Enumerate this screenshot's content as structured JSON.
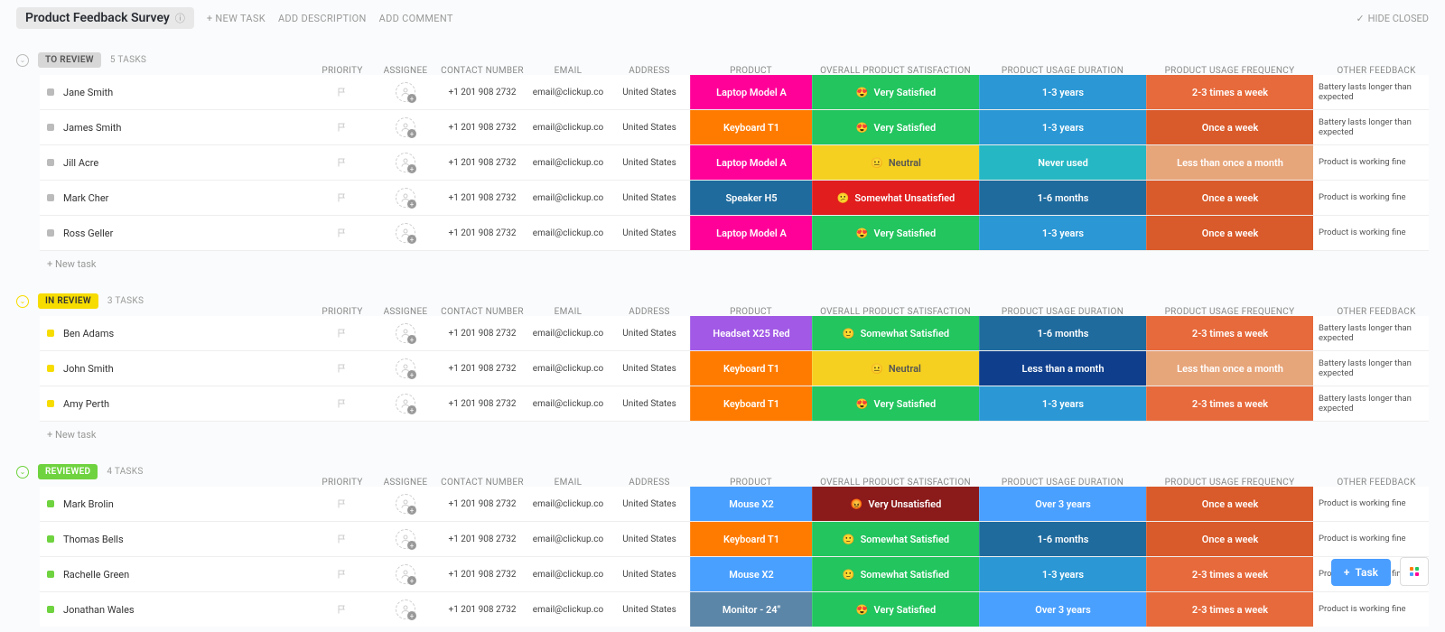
{
  "header": {
    "title": "Product Feedback Survey",
    "new_task": "+ NEW TASK",
    "add_description": "ADD DESCRIPTION",
    "add_comment": "ADD COMMENT",
    "hide_closed": "HIDE CLOSED"
  },
  "columns": {
    "priority": "PRIORITY",
    "assignee": "ASSIGNEE",
    "contact": "CONTACT NUMBER",
    "email": "EMAIL",
    "address": "ADDRESS",
    "product": "PRODUCT",
    "satisfaction": "OVERALL PRODUCT SATISFACTION",
    "duration": "PRODUCT USAGE DURATION",
    "frequency": "PRODUCT USAGE FREQUENCY",
    "feedback": "OTHER FEEDBACK"
  },
  "new_task_label": "+ New task",
  "fab_label": "Task",
  "colors": {
    "product": {
      "Laptop Model A": "#ff0099",
      "Keyboard T1": "#ff7b00",
      "Speaker H5": "#1f6b9e",
      "Headset X25 Red": "#a259e6",
      "Mouse X2": "#4aa0ff",
      "Monitor - 24\"": "#5b86a8"
    },
    "satisfaction": {
      "Very Satisfied": "#22c55e",
      "Neutral": "#f5d020",
      "Somewhat Unsatisfied": "#e11d1d",
      "Somewhat Satisfied": "#22c55e",
      "Very Unsatisfied": "#8b1a1a"
    },
    "duration": {
      "1-3 years": "#2b98d5",
      "Never used": "#25b7c4",
      "1-6 months": "#1f6b9e",
      "Less than a month": "#0f3f8c",
      "Over 3 years": "#4aa0ff"
    },
    "frequency": {
      "2-3 times a week": "#e76a3c",
      "Once a week": "#d95a2a",
      "Less than once a month": "#e7a57a"
    }
  },
  "emoji": {
    "Very Satisfied": "😍",
    "Neutral": "😐",
    "Somewhat Unsatisfied": "😕",
    "Somewhat Satisfied": "🙂",
    "Very Unsatisfied": "😡"
  },
  "groups": [
    {
      "status": "TO REVIEW",
      "count": "5 TASKS",
      "pill_bg": "#d7d7d7",
      "pill_fg": "#555",
      "collapse_color": "#bbb",
      "sq_color": "#bbb",
      "tasks": [
        {
          "name": "Jane Smith",
          "contact": "+1 201 908 2732",
          "email": "email@clickup.co",
          "address": "United States",
          "product": "Laptop Model A",
          "satisfaction": "Very Satisfied",
          "duration": "1-3 years",
          "frequency": "2-3 times a week",
          "feedback": "Battery lasts longer than expected"
        },
        {
          "name": "James Smith",
          "contact": "+1 201 908 2732",
          "email": "email@clickup.co",
          "address": "United States",
          "product": "Keyboard T1",
          "satisfaction": "Very Satisfied",
          "duration": "1-3 years",
          "frequency": "Once a week",
          "feedback": "Battery lasts longer than expected"
        },
        {
          "name": "Jill Acre",
          "contact": "+1 201 908 2732",
          "email": "email@clickup.co",
          "address": "United States",
          "product": "Laptop Model A",
          "satisfaction": "Neutral",
          "duration": "Never used",
          "frequency": "Less than once a month",
          "feedback": "Product is working fine"
        },
        {
          "name": "Mark Cher",
          "contact": "+1 201 908 2732",
          "email": "email@clickup.co",
          "address": "United States",
          "product": "Speaker H5",
          "satisfaction": "Somewhat Unsatisfied",
          "duration": "1-6 months",
          "frequency": "Once a week",
          "feedback": "Product is working fine"
        },
        {
          "name": "Ross Geller",
          "contact": "+1 201 908 2732",
          "email": "email@clickup.co",
          "address": "United States",
          "product": "Laptop Model A",
          "satisfaction": "Very Satisfied",
          "duration": "1-3 years",
          "frequency": "Once a week",
          "feedback": "Product is working fine"
        }
      ]
    },
    {
      "status": "IN REVIEW",
      "count": "3 TASKS",
      "pill_bg": "#f7dc00",
      "pill_fg": "#333",
      "collapse_color": "#f7dc00",
      "sq_color": "#f7dc00",
      "tasks": [
        {
          "name": "Ben Adams",
          "contact": "+1 201 908 2732",
          "email": "email@clickup.co",
          "address": "United States",
          "product": "Headset X25 Red",
          "satisfaction": "Somewhat Satisfied",
          "duration": "1-6 months",
          "frequency": "2-3 times a week",
          "feedback": "Battery lasts longer than expected"
        },
        {
          "name": "John Smith",
          "contact": "+1 201 908 2732",
          "email": "email@clickup.co",
          "address": "United States",
          "product": "Keyboard T1",
          "satisfaction": "Neutral",
          "duration": "Less than a month",
          "frequency": "Less than once a month",
          "feedback": "Battery lasts longer than expected"
        },
        {
          "name": "Amy Perth",
          "contact": "+1 201 908 2732",
          "email": "email@clickup.co",
          "address": "United States",
          "product": "Keyboard T1",
          "satisfaction": "Very Satisfied",
          "duration": "1-3 years",
          "frequency": "2-3 times a week",
          "feedback": "Battery lasts longer than expected"
        }
      ]
    },
    {
      "status": "REVIEWED",
      "count": "4 TASKS",
      "pill_bg": "#6fd33f",
      "pill_fg": "#fff",
      "collapse_color": "#6fd33f",
      "sq_color": "#6fd33f",
      "tasks": [
        {
          "name": "Mark Brolin",
          "contact": "+1 201 908 2732",
          "email": "email@clickup.co",
          "address": "United States",
          "product": "Mouse X2",
          "satisfaction": "Very Unsatisfied",
          "duration": "Over 3 years",
          "frequency": "Once a week",
          "feedback": "Product is working fine"
        },
        {
          "name": "Thomas Bells",
          "contact": "+1 201 908 2732",
          "email": "email@clickup.co",
          "address": "United States",
          "product": "Keyboard T1",
          "satisfaction": "Somewhat Satisfied",
          "duration": "1-6 months",
          "frequency": "Once a week",
          "feedback": "Product is working fine"
        },
        {
          "name": "Rachelle Green",
          "contact": "+1 201 908 2732",
          "email": "email@clickup.co",
          "address": "United States",
          "product": "Mouse X2",
          "satisfaction": "Somewhat Satisfied",
          "duration": "1-3 years",
          "frequency": "2-3 times a week",
          "feedback": "Product is working fine"
        },
        {
          "name": "Jonathan Wales",
          "contact": "+1 201 908 2732",
          "email": "email@clickup.co",
          "address": "United States",
          "product": "Monitor - 24\"",
          "satisfaction": "Very Satisfied",
          "duration": "Over 3 years",
          "frequency": "2-3 times a week",
          "feedback": "Product is working fine"
        }
      ]
    }
  ]
}
